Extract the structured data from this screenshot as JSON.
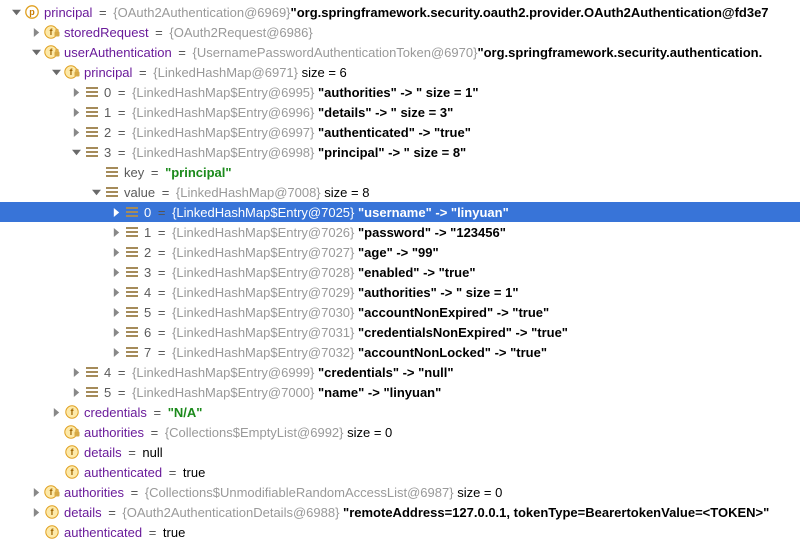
{
  "colors": {
    "selected_bg": "#3874d8"
  },
  "rows": [
    {
      "id": "r0",
      "indent": 0,
      "arrow": "down",
      "icon": "p-circle",
      "name": "principal",
      "ref": "{OAuth2Authentication@6969}",
      "value": "\"org.springframework.security.oauth2.provider.OAuth2Authentication@fd3e7",
      "valueClass": "bold"
    },
    {
      "id": "r1",
      "indent": 1,
      "arrow": "right",
      "icon": "f-lock",
      "name": "storedRequest",
      "ref": "{OAuth2Request@6986}"
    },
    {
      "id": "r2",
      "indent": 1,
      "arrow": "down",
      "icon": "f-lock",
      "name": "userAuthentication",
      "ref": "{UsernamePasswordAuthenticationToken@6970}",
      "value": "\"org.springframework.security.authentication.",
      "valueClass": "bold"
    },
    {
      "id": "r3",
      "indent": 2,
      "arrow": "down",
      "icon": "f-lock-tag",
      "name": "principal",
      "ref": "{LinkedHashMap@6971}",
      "value": " size = 6",
      "valueClass": "val",
      "noEqBefore": true
    },
    {
      "id": "r4",
      "indent": 3,
      "arrow": "right",
      "icon": "list",
      "name": "0",
      "nameClass": "kw",
      "ref": "{LinkedHashMap$Entry@6995}",
      "value": "\"authorities\" -> \" size = 1\"",
      "valueClass": "bold",
      "noEqBefore": true
    },
    {
      "id": "r5",
      "indent": 3,
      "arrow": "right",
      "icon": "list",
      "name": "1",
      "nameClass": "kw",
      "ref": "{LinkedHashMap$Entry@6996}",
      "value": "\"details\" -> \" size = 3\"",
      "valueClass": "bold",
      "noEqBefore": true
    },
    {
      "id": "r6",
      "indent": 3,
      "arrow": "right",
      "icon": "list",
      "name": "2",
      "nameClass": "kw",
      "ref": "{LinkedHashMap$Entry@6997}",
      "value": "\"authenticated\" -> \"true\"",
      "valueClass": "bold",
      "noEqBefore": true
    },
    {
      "id": "r7",
      "indent": 3,
      "arrow": "down",
      "icon": "list",
      "name": "3",
      "nameClass": "kw",
      "ref": "{LinkedHashMap$Entry@6998}",
      "value": "\"principal\" -> \" size = 8\"",
      "valueClass": "bold",
      "noEqBefore": true
    },
    {
      "id": "r8",
      "indent": 4,
      "arrow": "none",
      "icon": "list",
      "name": "key",
      "nameClass": "kw",
      "eq": "=",
      "lit": "\"principal\""
    },
    {
      "id": "r9",
      "indent": 4,
      "arrow": "down",
      "icon": "list",
      "name": "value",
      "nameClass": "kw",
      "ref": "{LinkedHashMap@7008}",
      "value": " size = 8",
      "valueClass": "val",
      "noEqBefore": true
    },
    {
      "id": "r10",
      "indent": 5,
      "arrow": "right",
      "icon": "list",
      "selected": true,
      "name": "0",
      "nameClass": "kw",
      "ref": "{LinkedHashMap$Entry@7025}",
      "value": "\"username\" -> \"linyuan\"",
      "valueClass": "bold",
      "noEqBefore": true
    },
    {
      "id": "r11",
      "indent": 5,
      "arrow": "right",
      "icon": "list",
      "name": "1",
      "nameClass": "kw",
      "ref": "{LinkedHashMap$Entry@7026}",
      "value": "\"password\" -> \"123456\"",
      "valueClass": "bold",
      "noEqBefore": true
    },
    {
      "id": "r12",
      "indent": 5,
      "arrow": "right",
      "icon": "list",
      "name": "2",
      "nameClass": "kw",
      "ref": "{LinkedHashMap$Entry@7027}",
      "value": "\"age\" -> \"99\"",
      "valueClass": "bold",
      "noEqBefore": true
    },
    {
      "id": "r13",
      "indent": 5,
      "arrow": "right",
      "icon": "list",
      "name": "3",
      "nameClass": "kw",
      "ref": "{LinkedHashMap$Entry@7028}",
      "value": "\"enabled\" -> \"true\"",
      "valueClass": "bold",
      "noEqBefore": true
    },
    {
      "id": "r14",
      "indent": 5,
      "arrow": "right",
      "icon": "list",
      "name": "4",
      "nameClass": "kw",
      "ref": "{LinkedHashMap$Entry@7029}",
      "value": "\"authorities\" -> \" size = 1\"",
      "valueClass": "bold",
      "noEqBefore": true
    },
    {
      "id": "r15",
      "indent": 5,
      "arrow": "right",
      "icon": "list",
      "name": "5",
      "nameClass": "kw",
      "ref": "{LinkedHashMap$Entry@7030}",
      "value": "\"accountNonExpired\" -> \"true\"",
      "valueClass": "bold",
      "noEqBefore": true
    },
    {
      "id": "r16",
      "indent": 5,
      "arrow": "right",
      "icon": "list",
      "name": "6",
      "nameClass": "kw",
      "ref": "{LinkedHashMap$Entry@7031}",
      "value": "\"credentialsNonExpired\" -> \"true\"",
      "valueClass": "bold",
      "noEqBefore": true
    },
    {
      "id": "r17",
      "indent": 5,
      "arrow": "right",
      "icon": "list",
      "name": "7",
      "nameClass": "kw",
      "ref": "{LinkedHashMap$Entry@7032}",
      "value": "\"accountNonLocked\" -> \"true\"",
      "valueClass": "bold",
      "noEqBefore": true
    },
    {
      "id": "r18",
      "indent": 3,
      "arrow": "right",
      "icon": "list",
      "name": "4",
      "nameClass": "kw",
      "ref": "{LinkedHashMap$Entry@6999}",
      "value": "\"credentials\" -> \"null\"",
      "valueClass": "bold",
      "noEqBefore": true
    },
    {
      "id": "r19",
      "indent": 3,
      "arrow": "right",
      "icon": "list",
      "name": "5",
      "nameClass": "kw",
      "ref": "{LinkedHashMap$Entry@7000}",
      "value": "\"name\" -> \"linyuan\"",
      "valueClass": "bold",
      "noEqBefore": true
    },
    {
      "id": "r20",
      "indent": 2,
      "arrow": "right",
      "icon": "f-circle",
      "name": "credentials",
      "eq": "=",
      "lit": "\"N/A\""
    },
    {
      "id": "r21",
      "indent": 2,
      "arrow": "none",
      "icon": "f-lock-tag",
      "name": "authorities",
      "ref": "{Collections$EmptyList@6992}",
      "value": " size = 0",
      "valueClass": "val",
      "noEqBefore": true
    },
    {
      "id": "r22",
      "indent": 2,
      "arrow": "none",
      "icon": "f-circle",
      "name": "details",
      "eq": "=",
      "value": "null",
      "valueClass": "val"
    },
    {
      "id": "r23",
      "indent": 2,
      "arrow": "none",
      "icon": "f-circle",
      "name": "authenticated",
      "eq": "=",
      "value": "true",
      "valueClass": "val"
    },
    {
      "id": "r24",
      "indent": 1,
      "arrow": "right",
      "icon": "f-lock-tag",
      "name": "authorities",
      "ref": "{Collections$UnmodifiableRandomAccessList@6987}",
      "value": " size = 0",
      "valueClass": "val",
      "noEqBefore": true
    },
    {
      "id": "r25",
      "indent": 1,
      "arrow": "right",
      "icon": "f-circle",
      "name": "details",
      "ref": "{OAuth2AuthenticationDetails@6988}",
      "value": "\"remoteAddress=127.0.0.1, tokenType=BearertokenValue=<TOKEN>\"",
      "valueClass": "bold",
      "noEqBefore": true
    },
    {
      "id": "r26",
      "indent": 1,
      "arrow": "none",
      "icon": "f-circle",
      "name": "authenticated",
      "eq": "=",
      "value": "true",
      "valueClass": "val"
    }
  ]
}
